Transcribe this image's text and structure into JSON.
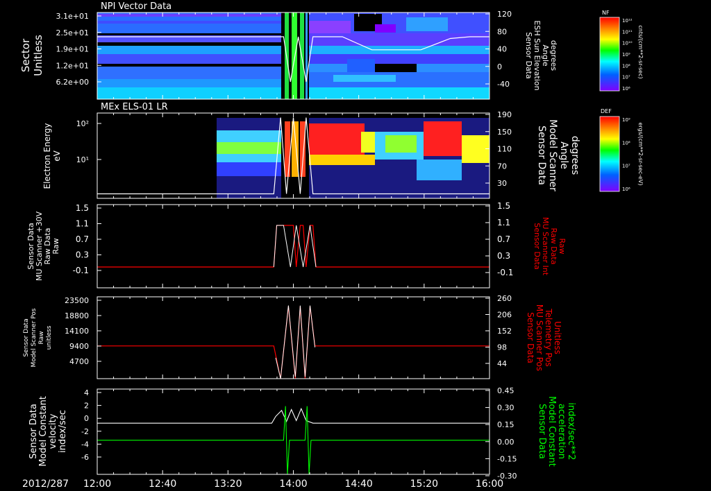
{
  "date_label": "2012/287",
  "time_ticks": [
    "12:00",
    "12:40",
    "13:20",
    "14:00",
    "14:40",
    "15:20",
    "16:00"
  ],
  "colors": {
    "frame": "#ffffff",
    "red": "#ff0000",
    "green": "#00ff00",
    "white": "#ffffff"
  },
  "chart_data": [
    {
      "type": "heatmap",
      "title": "NPI Vector Data",
      "ylabel": [
        "Sector",
        "Unitless"
      ],
      "left_ticks": [
        "3.1e+01",
        "2.5e+01",
        "1.9e+01",
        "1.2e+01",
        "6.2e+00"
      ],
      "right_ticks": [
        "120",
        "80",
        "40",
        "0",
        "-40"
      ],
      "right_label": [
        "Sensor Data",
        "ESH Sun Elevation",
        "Angle",
        "degrees"
      ],
      "right_range": [
        -80,
        120
      ],
      "overlay_line": {
        "color": "#ffffff",
        "x_hours": [
          12.0,
          13.8,
          13.9,
          13.97,
          14.05,
          14.13,
          14.2,
          14.5,
          14.8,
          15.3,
          15.6,
          15.8,
          16.0
        ],
        "y": [
          64,
          64,
          64,
          -40,
          64,
          -40,
          64,
          64,
          34,
          34,
          60,
          64,
          64
        ]
      },
      "colorbar": {
        "label": "NF",
        "ticks": [
          "10¹²",
          "10¹¹",
          "10¹⁰",
          "10⁹",
          "10⁸",
          "10⁷",
          "10⁶"
        ],
        "units": "cnts/(cm**2-sr-sec)"
      }
    },
    {
      "type": "heatmap",
      "title": "MEx ELS-01 LR",
      "ylabel": [
        "Electron Energy",
        "eV"
      ],
      "left_ticks": [
        "10²",
        "10¹"
      ],
      "right_ticks": [
        "190",
        "150",
        "110",
        "70",
        "30"
      ],
      "right_label": [
        "Sensor Data",
        "Model Scanner",
        "Angle",
        "degrees"
      ],
      "right_range": [
        0,
        190
      ],
      "overlay_line": {
        "color": "#ffffff",
        "x_hours": [
          12.0,
          13.8,
          13.87,
          13.93,
          14.0,
          14.07,
          14.13,
          14.2,
          16.0
        ],
        "y": [
          10,
          10,
          180,
          10,
          180,
          10,
          180,
          10,
          10
        ]
      },
      "colorbar": {
        "label": "DEF",
        "ticks": [
          "10⁹",
          "10⁸",
          "10⁷",
          "10⁶"
        ],
        "units": "ergs/(cm**2-sr-sec-eV)"
      }
    },
    {
      "type": "line",
      "ylabel": [
        "Sensor Data",
        "MU Scanner +30V",
        "Raw Data",
        "Raw"
      ],
      "left_ticks": [
        "1.5",
        "1.1",
        "0.7",
        "0.3",
        "-0.1"
      ],
      "right_ticks": [
        "1.5",
        "1.1",
        "0.7",
        "0.3",
        "-0.1"
      ],
      "right_label": [
        "Sensor Data",
        "MU Scanner Int",
        "Raw Data",
        "Raw"
      ],
      "ylim": [
        -0.5,
        1.5
      ],
      "series": [
        {
          "color": "#ff0000",
          "x_hours": [
            12.0,
            13.8,
            13.83,
            14.0,
            14.03,
            14.07,
            14.1,
            14.13,
            14.17,
            14.2,
            14.23,
            16.0
          ],
          "y": [
            0,
            0,
            1,
            1,
            0,
            1,
            1,
            0,
            1,
            1,
            0,
            0
          ]
        },
        {
          "color": "#ffffff",
          "x_hours": [
            13.8,
            13.83,
            13.9,
            13.97,
            14.03,
            14.1,
            14.17,
            14.23
          ],
          "y": [
            0,
            1,
            1,
            0,
            1,
            0,
            1,
            0
          ]
        }
      ]
    },
    {
      "type": "line",
      "ylabel": [
        "Sensor Data",
        "Model Scanner Pos",
        "Raw",
        "unitless"
      ],
      "left_ticks": [
        "23500",
        "18800",
        "14100",
        "9400",
        "4700"
      ],
      "right_ticks": [
        "260",
        "206",
        "152",
        "98",
        "44"
      ],
      "right_label": [
        "Sensor Data",
        "MU Scanner Pos",
        "Telemetry Pos",
        "Unitless"
      ],
      "ylim": [
        0,
        23500
      ],
      "series": [
        {
          "color": "#ff0000",
          "x_hours": [
            12.0,
            13.8,
            13.87,
            13.95,
            14.02,
            14.07,
            14.12,
            14.17,
            14.22,
            16.0
          ],
          "y": [
            9400,
            9400,
            0,
            20800,
            0,
            20800,
            0,
            20800,
            9400,
            9400
          ]
        },
        {
          "color": "#ffffff",
          "x_hours": [
            13.82,
            13.87,
            13.95,
            14.02,
            14.07,
            14.12,
            14.17,
            14.22
          ],
          "y": [
            6000,
            0,
            21000,
            500,
            21000,
            500,
            21000,
            9000
          ]
        }
      ]
    },
    {
      "type": "line",
      "ylabel": [
        "Sensor Data",
        "Model Constant",
        "velocity",
        "index/sec"
      ],
      "left_ticks": [
        "4",
        "2",
        "0",
        "-2",
        "-4",
        "-6"
      ],
      "right_ticks": [
        "0.45",
        "0.30",
        "0.15",
        "0.00",
        "-0.15",
        "-0.30"
      ],
      "right_label": [
        "Sensor Data",
        "Model Constant",
        "acceleration",
        "index/sec**2"
      ],
      "ylim": [
        -6,
        4
      ],
      "series": [
        {
          "color": "#ffffff",
          "x_hours": [
            12.0,
            13.78,
            13.82,
            13.88,
            13.93,
            13.98,
            14.03,
            14.08,
            14.13,
            14.2,
            16.0
          ],
          "y": [
            0,
            0,
            0.8,
            1.5,
            0.2,
            1.6,
            0.3,
            1.7,
            0.3,
            0,
            0
          ]
        },
        {
          "color": "#00ff00",
          "x_hours": [
            12.0,
            13.9,
            13.92,
            13.94,
            13.96,
            14.12,
            14.14,
            14.16,
            14.18,
            16.0
          ],
          "y": [
            -2,
            -2,
            2,
            -6,
            -2,
            -2,
            2,
            -6,
            -2,
            -2
          ]
        }
      ]
    }
  ]
}
